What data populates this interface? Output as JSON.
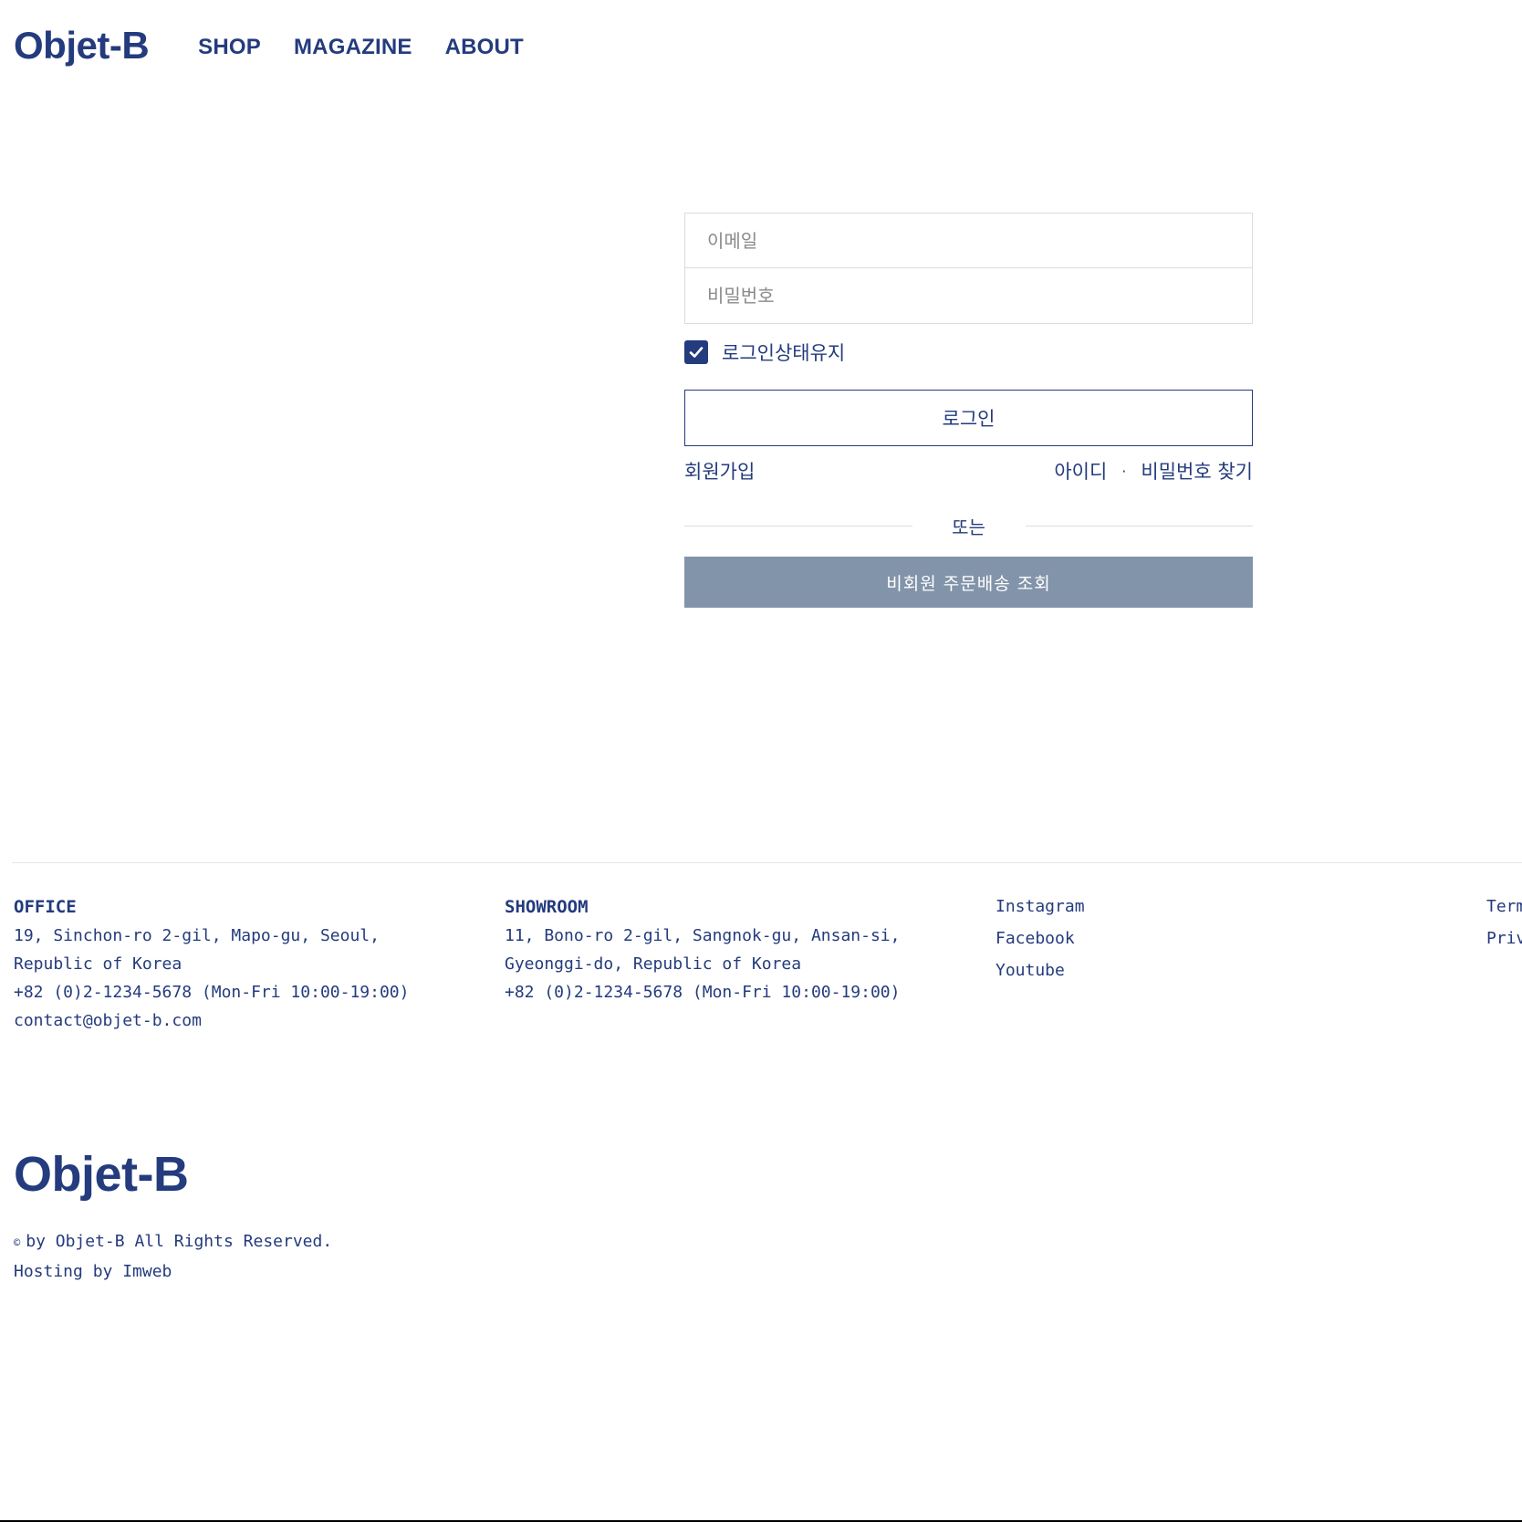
{
  "header": {
    "logo": "Objet-B",
    "nav": [
      "SHOP",
      "MAGAZINE",
      "ABOUT"
    ]
  },
  "login": {
    "email_placeholder": "이메일",
    "password_placeholder": "비밀번호",
    "remember_label": "로그인상태유지",
    "remember_checked": true,
    "login_button": "로그인",
    "signup_link": "회원가입",
    "find_id": "아이디",
    "separator": "·",
    "find_password": "비밀번호 찾기",
    "divider_text": "또는",
    "guest_button": "비회원 주문배송 조회"
  },
  "footer": {
    "office": {
      "heading": "OFFICE",
      "lines": [
        "19, Sinchon-ro 2-gil, Mapo-gu, Seoul,",
        "Republic of Korea",
        "+82 (0)2-1234-5678 (Mon-Fri 10:00-19:00)",
        "contact@objet-b.com"
      ]
    },
    "showroom": {
      "heading": "SHOWROOM",
      "lines": [
        "11, Bono-ro 2-gil, Sangnok-gu, Ansan-si,",
        "Gyeonggi-do, Republic of Korea",
        "+82 (0)2-1234-5678 (Mon-Fri 10:00-19:00)"
      ]
    },
    "social": [
      "Instagram",
      "Facebook",
      "Youtube"
    ],
    "legal": [
      "Term",
      "Priv"
    ],
    "logo": "Objet-B",
    "copyright_symbol": "©",
    "copyright": "by Objet-B All Rights Reserved.",
    "hosting": "Hosting by Imweb"
  },
  "colors": {
    "brand": "#243b7d",
    "guest_button_bg": "#8294aa",
    "border": "#dcdcdc"
  }
}
